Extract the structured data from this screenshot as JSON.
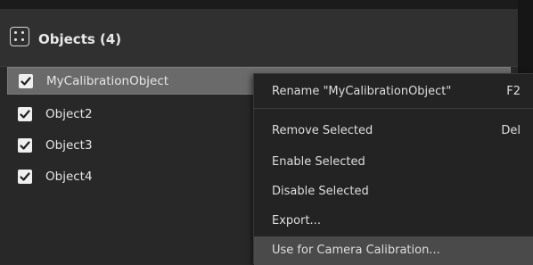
{
  "panel": {
    "title": "Objects (4)",
    "icon": "dots-grid-icon",
    "items": [
      {
        "label": "MyCalibrationObject",
        "checked": true,
        "selected": true
      },
      {
        "label": "Object2",
        "checked": true,
        "selected": false
      },
      {
        "label": "Object3",
        "checked": true,
        "selected": false
      },
      {
        "label": "Object4",
        "checked": true,
        "selected": false
      }
    ]
  },
  "context_menu": {
    "items": [
      {
        "label": "Rename \"MyCalibrationObject\"",
        "shortcut": "F2"
      },
      {
        "label": "Remove Selected",
        "shortcut": "Del"
      },
      {
        "label": "Enable Selected",
        "shortcut": ""
      },
      {
        "label": "Disable Selected",
        "shortcut": ""
      },
      {
        "label": "Export...",
        "shortcut": ""
      },
      {
        "label": "Use for Camera Calibration...",
        "shortcut": "",
        "highlighted": true
      }
    ]
  }
}
